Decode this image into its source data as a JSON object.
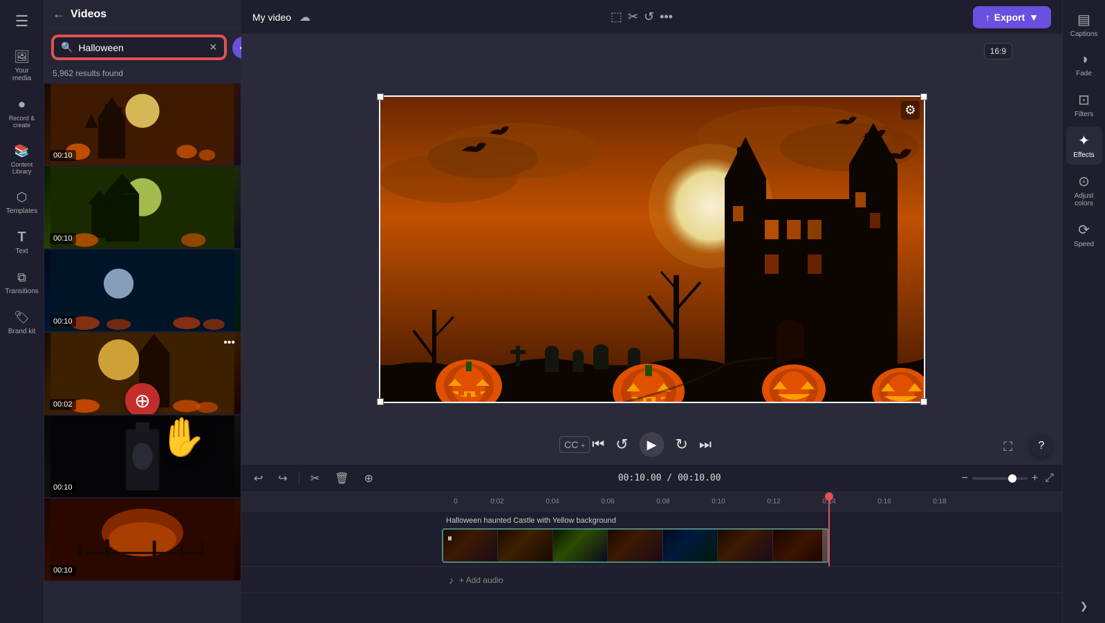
{
  "app": {
    "title": "Videos"
  },
  "left_nav": {
    "menu_icon": "☰",
    "items": [
      {
        "id": "my-media",
        "icon": "🖼",
        "label": "Your media"
      },
      {
        "id": "record",
        "icon": "⏺",
        "label": "Record &\ncreate"
      },
      {
        "id": "content-library",
        "icon": "📚",
        "label": "Content Library"
      },
      {
        "id": "templates",
        "icon": "⬡",
        "label": "Templates"
      },
      {
        "id": "text",
        "icon": "T",
        "label": "Text"
      },
      {
        "id": "transitions",
        "icon": "⧉",
        "label": "Transitions"
      },
      {
        "id": "brand-kit",
        "icon": "🏷",
        "label": "Brand kit"
      }
    ]
  },
  "panel": {
    "back_label": "←",
    "title": "Videos",
    "search": {
      "placeholder": "Halloween",
      "value": "Halloween",
      "clear_icon": "✕"
    },
    "diamond_icon": "◆",
    "results_count": "5,962 results found",
    "videos": [
      {
        "id": "v1",
        "duration": "00:10",
        "theme": "1",
        "alt": "Halloween haunted house moonlit"
      },
      {
        "id": "v2",
        "duration": "00:10",
        "theme": "2",
        "alt": "Halloween green moonlit castle"
      },
      {
        "id": "v3",
        "duration": "00:10",
        "theme": "3",
        "alt": "Halloween blue night pumpkins"
      },
      {
        "id": "v4",
        "duration": "00:02",
        "theme": "4",
        "alt": "Halloween pumpkins moonlit",
        "more": true
      },
      {
        "id": "v5",
        "duration": "00:10",
        "theme": "5",
        "alt": "Dark horror figure"
      },
      {
        "id": "v6",
        "duration": "00:10",
        "theme": "6",
        "alt": "Halloween sunset graveyard"
      }
    ]
  },
  "top_bar": {
    "project_name": "My video",
    "cloud_icon": "☁",
    "export_label": "Export",
    "export_icon": "↑"
  },
  "preview": {
    "tools": [
      "⬚",
      "✂",
      "↺",
      "•••"
    ],
    "aspect_ratio": "16:9",
    "settings_icon": "⚙",
    "cc_label": "CC+",
    "controls": {
      "rewind": "⏮",
      "back5": "↺",
      "play": "▶",
      "fwd5": "↻",
      "skip": "⏭"
    },
    "fullscreen_icon": "⛶",
    "help_icon": "?"
  },
  "timeline": {
    "toolbar": {
      "undo": "↩",
      "redo": "↪",
      "cut": "✂",
      "delete": "🗑",
      "save": "⊕"
    },
    "timecode": "00:10.00 / 00:10.00",
    "zoom_in": "+",
    "zoom_out": "−",
    "expand": "⤢",
    "ruler_marks": [
      "0",
      "0:02",
      "0:04",
      "0:06",
      "0:08",
      "0:10",
      "0:12",
      "0:14",
      "0:16",
      "0:18"
    ],
    "clip": {
      "label": "Halloween haunted Castle with Yellow background",
      "start_pct": 0,
      "width_pct": 44,
      "playhead_pct": 44
    },
    "audio": {
      "add_label": "+ Add audio",
      "music_icon": "♪"
    }
  },
  "right_sidebar": {
    "items": [
      {
        "id": "captions",
        "icon": "▤",
        "label": "Captions"
      },
      {
        "id": "fade",
        "icon": "◑",
        "label": "Fade"
      },
      {
        "id": "filters",
        "icon": "⊡",
        "label": "Filters"
      },
      {
        "id": "effects",
        "icon": "✦",
        "label": "Effects",
        "active": true
      },
      {
        "id": "adjust-colors",
        "icon": "⊙",
        "label": "Adjust colors"
      },
      {
        "id": "speed",
        "icon": "⟳",
        "label": "Speed"
      }
    ],
    "scroll_chevron": "❮"
  }
}
